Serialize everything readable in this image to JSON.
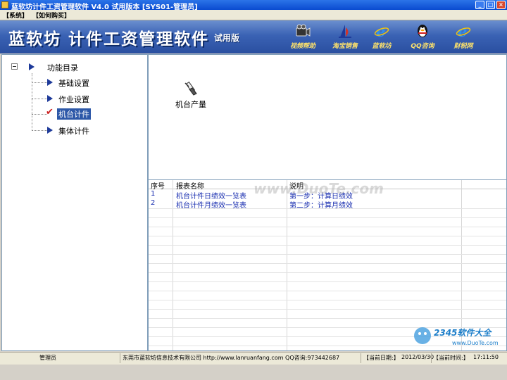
{
  "window": {
    "title": "蓝软坊计件工资管理软件 V4.0 试用版本 [SYS01-管理员]",
    "buttons": [
      "_",
      "□",
      "×"
    ]
  },
  "menu": {
    "items": [
      "【系统】",
      "【如何购买】"
    ]
  },
  "banner": {
    "title": "蓝软坊 计件工资管理软件",
    "subtitle": "试用版",
    "tools": [
      {
        "label": "视频帮助",
        "icon": "video-camera-icon"
      },
      {
        "label": "淘宝销售",
        "icon": "taobao-sail-icon"
      },
      {
        "label": "蓝软坊",
        "icon": "ie-browser-icon"
      },
      {
        "label": "QQ咨询",
        "icon": "qq-penguin-icon"
      },
      {
        "label": "财税网",
        "icon": "ie-browser-icon"
      }
    ]
  },
  "tree": {
    "root": "功能目录",
    "items": [
      {
        "label": "基础设置",
        "selected": false
      },
      {
        "label": "作业设置",
        "selected": false
      },
      {
        "label": "机台计件",
        "selected": true
      },
      {
        "label": "集体计件",
        "selected": false
      }
    ]
  },
  "panel": {
    "report_label": "机台产量"
  },
  "table": {
    "headers": [
      "序号",
      "报表名称",
      "说明"
    ],
    "rows": [
      [
        "1",
        "机台计件日绩效一览表",
        "第一步：计算日绩效"
      ],
      [
        "2",
        "机台计件月绩效一览表",
        "第二步：计算月绩效"
      ]
    ]
  },
  "watermark": "www.DuoTe.com",
  "logo": {
    "text": "2345软件大全",
    "url": "www.DuoTe.com"
  },
  "status": {
    "user": "管理员",
    "company": "东莞市蓝软坊信息技术有限公司 http://www.lanruanfang.com QQ咨询:973442687",
    "date_label": "【当前日期:】",
    "date_value": "2012/03/30",
    "time_label": "【当前时间:】",
    "time_value": "17:11:50"
  },
  "colors": {
    "banner": "#3a62b4",
    "selection": "#2d58a8",
    "table_text": "#1a2fb0",
    "check": "#cc1e1e",
    "tool_label": "#ffe36a"
  }
}
